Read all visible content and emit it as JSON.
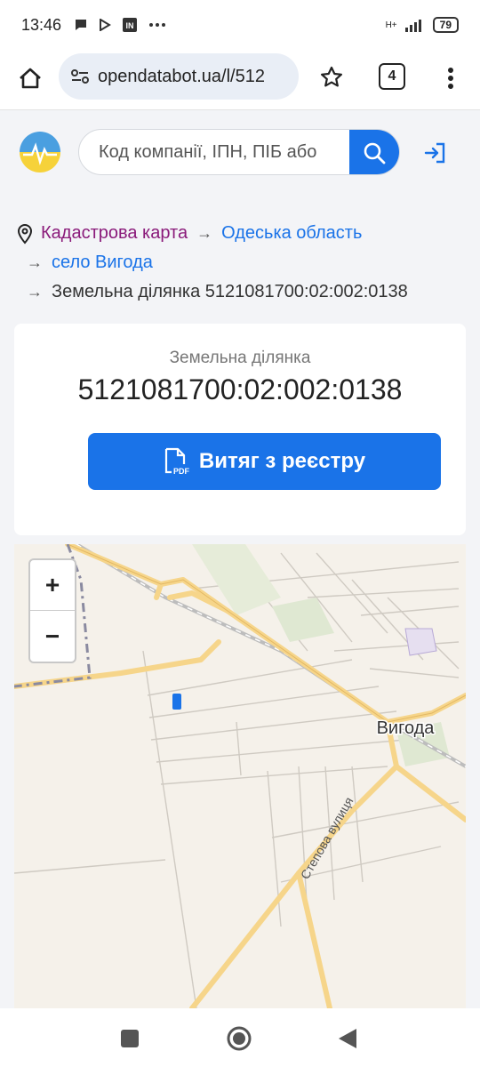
{
  "status": {
    "time": "13:46",
    "network": "H+",
    "battery": "79"
  },
  "browser": {
    "url": "opendatabot.ua/l/512",
    "tab_count": "4"
  },
  "search": {
    "placeholder": "Код компанії, ІПН, ПІБ або"
  },
  "breadcrumbs": {
    "items": [
      "Кадастрова карта",
      "Одеська область",
      "село Вигода",
      "Земельна ділянка 5121081700:02:002:0138"
    ],
    "separator": "→"
  },
  "card": {
    "label": "Земельна ділянка",
    "number": "5121081700:02:002:0138",
    "button": "Витяг з реєстру",
    "pdf_tag": "PDF"
  },
  "map": {
    "zoom_in": "+",
    "zoom_out": "−",
    "city_label": "Вигода",
    "street_label": "Степова вулиця",
    "colors": {
      "road": "#f6d58a",
      "land": "#f5f1ea",
      "green": "#dfe8d2"
    }
  },
  "colors": {
    "accent": "#1a73e8",
    "breadcrumb_first": "#8a1a7a"
  }
}
